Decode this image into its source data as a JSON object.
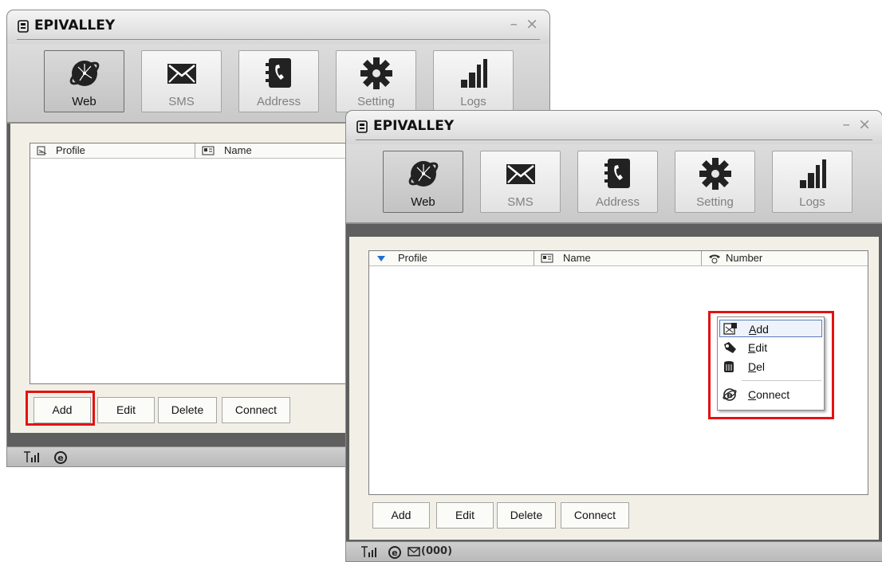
{
  "app": {
    "title": "EPIVALLEY",
    "window_controls": "– ×"
  },
  "toolbar": {
    "items": [
      {
        "label": "Web",
        "icon": "globe-icon",
        "active": true
      },
      {
        "label": "SMS",
        "icon": "envelope-icon",
        "active": false
      },
      {
        "label": "Address",
        "icon": "phone-book-icon",
        "active": false
      },
      {
        "label": "Setting",
        "icon": "gear-icon",
        "active": false
      },
      {
        "label": "Logs",
        "icon": "bar-chart-icon",
        "active": false
      }
    ]
  },
  "back_window": {
    "columns": [
      {
        "label": "Profile",
        "icon": "profile-icon"
      },
      {
        "label": "Name",
        "icon": "name-card-icon"
      }
    ],
    "buttons": {
      "add": "Add",
      "edit": "Edit",
      "delete": "Delete",
      "connect": "Connect"
    }
  },
  "front_window": {
    "columns": [
      {
        "label": "Profile",
        "icon": "sort-desc-icon"
      },
      {
        "label": "Name",
        "icon": "name-card-icon"
      },
      {
        "label": "Number",
        "icon": "telephone-icon"
      }
    ],
    "buttons": {
      "add": "Add",
      "edit": "Edit",
      "delete": "Delete",
      "connect": "Connect"
    },
    "context_menu": {
      "items": [
        {
          "label": "Add",
          "mnemonic": "A",
          "icon": "add-profile-icon",
          "selected": true
        },
        {
          "label": "Edit",
          "mnemonic": "E",
          "icon": "edit-profile-icon",
          "selected": false
        },
        {
          "label": "Del",
          "mnemonic": "D",
          "icon": "trash-icon",
          "selected": false
        },
        {
          "label": "Connect",
          "mnemonic": "C",
          "icon": "internet-icon",
          "selected": false
        }
      ]
    },
    "status": {
      "sms_count": "(000)"
    }
  },
  "colors": {
    "highlight": "#e31212",
    "window_frame": "#5f5f5f",
    "panel": "#f2f0e6"
  }
}
